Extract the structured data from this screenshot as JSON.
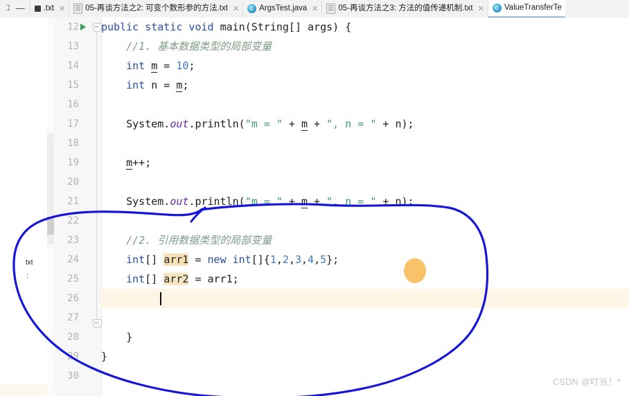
{
  "window": {
    "lead_glyph": "⌶",
    "lead_dash": "—"
  },
  "tabs": [
    {
      "label": ".txt",
      "icon": "txt-file-icon",
      "active": false,
      "close": "✕"
    },
    {
      "label": "05-再谈方法之2: 可变个数形参的方法.txt",
      "icon": "txt-file-icon",
      "active": false,
      "close": "✕"
    },
    {
      "label": "ArgsTest.java",
      "icon": "java-class-icon",
      "active": false,
      "close": "✕"
    },
    {
      "label": "05-再谈方法之3: 方法的值传递机制.txt",
      "icon": "txt-file-icon",
      "active": false,
      "close": "✕"
    },
    {
      "label": "ValueTransferTe",
      "icon": "java-class-icon",
      "active": true,
      "close": ""
    }
  ],
  "editor": {
    "left_fragment_text": "txt",
    "left_fragment_colon": ":",
    "gutter_lines": [
      "12",
      "13",
      "14",
      "15",
      "16",
      "17",
      "18",
      "19",
      "20",
      "21",
      "22",
      "23",
      "24",
      "25",
      "26",
      "27",
      "28",
      "29",
      "30"
    ],
    "current_line_number": "26",
    "code_lines": [
      {
        "n": "12",
        "segments": [
          {
            "t": "public static void ",
            "c": "kw"
          },
          {
            "t": "main",
            "c": "pln"
          },
          {
            "t": "(String[] args) {",
            "c": "pln"
          }
        ]
      },
      {
        "n": "13",
        "segments": [
          {
            "t": "    //1. 基本数据类型的局部变量",
            "c": "cmt"
          }
        ]
      },
      {
        "n": "14",
        "segments": [
          {
            "t": "    ",
            "c": "pln"
          },
          {
            "t": "int",
            "c": "kw"
          },
          {
            "t": " ",
            "c": "pln"
          },
          {
            "t": "m",
            "c": "under"
          },
          {
            "t": " = ",
            "c": "pln"
          },
          {
            "t": "10",
            "c": "num"
          },
          {
            "t": ";",
            "c": "pln"
          }
        ]
      },
      {
        "n": "15",
        "segments": [
          {
            "t": "    ",
            "c": "pln"
          },
          {
            "t": "int",
            "c": "kw"
          },
          {
            "t": " n = ",
            "c": "pln"
          },
          {
            "t": "m",
            "c": "under"
          },
          {
            "t": ";",
            "c": "pln"
          }
        ]
      },
      {
        "n": "16",
        "segments": []
      },
      {
        "n": "17",
        "segments": [
          {
            "t": "    System.",
            "c": "pln"
          },
          {
            "t": "out",
            "c": "fld"
          },
          {
            "t": ".println(",
            "c": "pln"
          },
          {
            "t": "\"m = \"",
            "c": "str"
          },
          {
            "t": " + ",
            "c": "pln"
          },
          {
            "t": "m",
            "c": "under"
          },
          {
            "t": " + ",
            "c": "pln"
          },
          {
            "t": "\", n = \"",
            "c": "str"
          },
          {
            "t": " + n);",
            "c": "pln"
          }
        ]
      },
      {
        "n": "18",
        "segments": []
      },
      {
        "n": "19",
        "segments": [
          {
            "t": "    ",
            "c": "pln"
          },
          {
            "t": "m",
            "c": "under"
          },
          {
            "t": "++;",
            "c": "pln"
          }
        ]
      },
      {
        "n": "20",
        "segments": []
      },
      {
        "n": "21",
        "segments": [
          {
            "t": "    System.",
            "c": "pln"
          },
          {
            "t": "out",
            "c": "fld"
          },
          {
            "t": ".println(",
            "c": "pln"
          },
          {
            "t": "\"m = \"",
            "c": "str"
          },
          {
            "t": " + ",
            "c": "pln"
          },
          {
            "t": "m",
            "c": "under"
          },
          {
            "t": " + ",
            "c": "pln"
          },
          {
            "t": "\", n = \"",
            "c": "str"
          },
          {
            "t": " + n);",
            "c": "pln"
          }
        ]
      },
      {
        "n": "22",
        "segments": []
      },
      {
        "n": "23",
        "segments": [
          {
            "t": "    //2. 引用数据类型的局部变量",
            "c": "cmt"
          }
        ]
      },
      {
        "n": "24",
        "segments": [
          {
            "t": "    ",
            "c": "pln"
          },
          {
            "t": "int",
            "c": "kw"
          },
          {
            "t": "[] ",
            "c": "pln"
          },
          {
            "t": "arr1",
            "c": "hl"
          },
          {
            "t": " = ",
            "c": "pln"
          },
          {
            "t": "new",
            "c": "kw"
          },
          {
            "t": " ",
            "c": "pln"
          },
          {
            "t": "int",
            "c": "kw"
          },
          {
            "t": "[]{",
            "c": "pln"
          },
          {
            "t": "1",
            "c": "num"
          },
          {
            "t": ",",
            "c": "pln"
          },
          {
            "t": "2",
            "c": "num"
          },
          {
            "t": ",",
            "c": "pln"
          },
          {
            "t": "3",
            "c": "num"
          },
          {
            "t": ",",
            "c": "pln"
          },
          {
            "t": "4",
            "c": "num"
          },
          {
            "t": ",",
            "c": "pln"
          },
          {
            "t": "5",
            "c": "num"
          },
          {
            "t": "};",
            "c": "pln"
          }
        ]
      },
      {
        "n": "25",
        "segments": [
          {
            "t": "    ",
            "c": "pln"
          },
          {
            "t": "int",
            "c": "kw"
          },
          {
            "t": "[] ",
            "c": "pln"
          },
          {
            "t": "arr2",
            "c": "hl2"
          },
          {
            "t": " = arr1;",
            "c": "pln"
          }
        ]
      },
      {
        "n": "26",
        "segments": []
      },
      {
        "n": "27",
        "segments": []
      },
      {
        "n": "28",
        "segments": [
          {
            "t": "    }",
            "c": "pln"
          }
        ]
      },
      {
        "n": "29",
        "segments": [
          {
            "t": "}",
            "c": "pln"
          }
        ]
      },
      {
        "n": "30",
        "segments": []
      }
    ]
  },
  "annotations": {
    "orange_dot_color": "#f8c368",
    "ellipse_color": "#1616d8"
  },
  "watermark": "CSDN @叮当！*"
}
